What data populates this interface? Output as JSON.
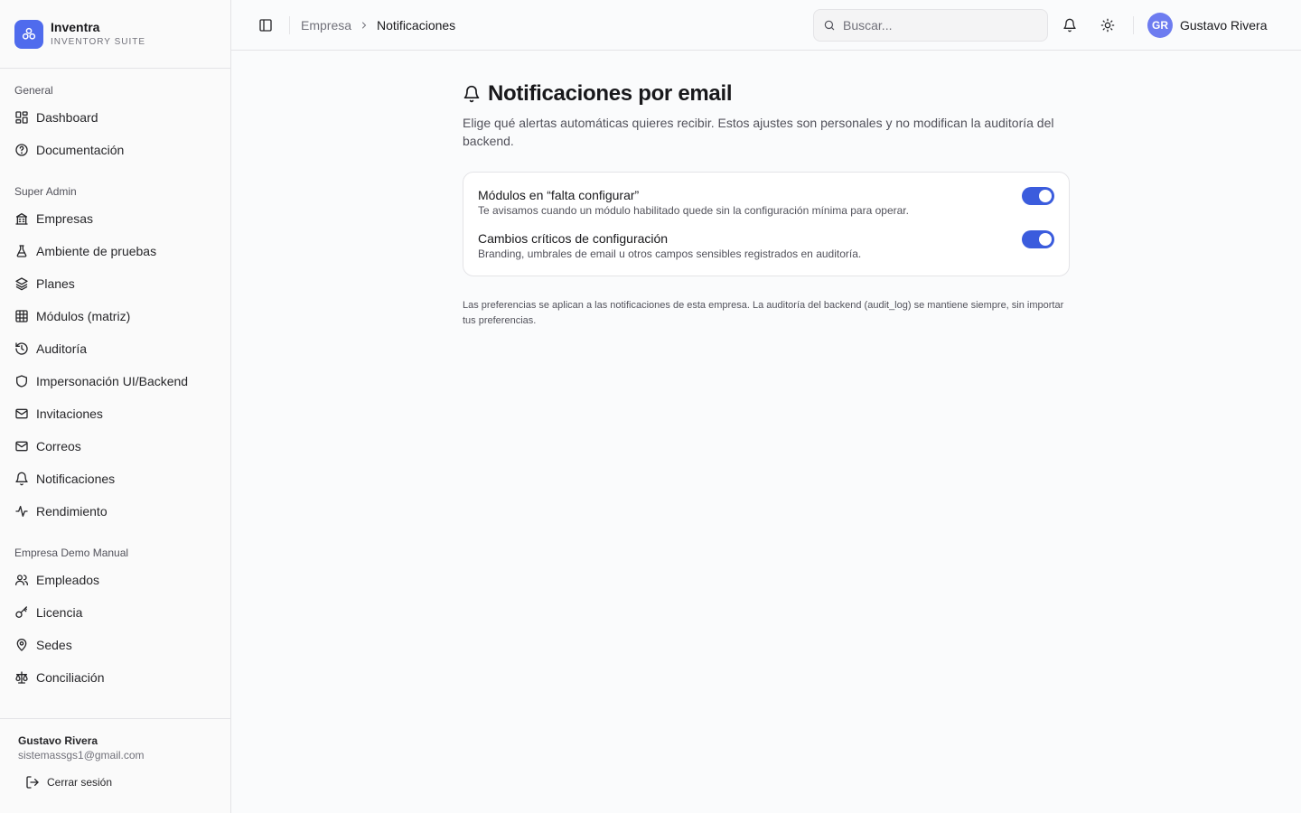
{
  "brand": {
    "name": "Inventra",
    "subtitle": "INVENTORY SUITE"
  },
  "sidebar": {
    "groups": [
      {
        "label": "General",
        "items": [
          {
            "label": "Dashboard",
            "icon": "dashboard-icon"
          },
          {
            "label": "Documentación",
            "icon": "help-circle-icon"
          }
        ]
      },
      {
        "label": "Super Admin",
        "items": [
          {
            "label": "Empresas",
            "icon": "building-icon"
          },
          {
            "label": "Ambiente de pruebas",
            "icon": "flask-icon"
          },
          {
            "label": "Planes",
            "icon": "layers-icon"
          },
          {
            "label": "Módulos (matriz)",
            "icon": "grid-icon"
          },
          {
            "label": "Auditoría",
            "icon": "history-icon"
          },
          {
            "label": "Impersonación UI/Backend",
            "icon": "shield-icon"
          },
          {
            "label": "Invitaciones",
            "icon": "mail-icon"
          },
          {
            "label": "Correos",
            "icon": "mail-icon"
          },
          {
            "label": "Notificaciones",
            "icon": "bell-icon"
          },
          {
            "label": "Rendimiento",
            "icon": "activity-icon"
          }
        ]
      },
      {
        "label": "Empresa Demo Manual",
        "items": [
          {
            "label": "Empleados",
            "icon": "users-icon"
          },
          {
            "label": "Licencia",
            "icon": "key-icon"
          },
          {
            "label": "Sedes",
            "icon": "map-pin-icon"
          },
          {
            "label": "Conciliación",
            "icon": "scale-icon"
          }
        ]
      }
    ],
    "footer": {
      "name": "Gustavo Rivera",
      "email": "sistemassgs1@gmail.com",
      "logout_label": "Cerrar sesión"
    }
  },
  "header": {
    "breadcrumb": {
      "parent": "Empresa",
      "current": "Notificaciones"
    },
    "search_placeholder": "Buscar...",
    "user": {
      "initials": "GR",
      "name": "Gustavo Rivera"
    }
  },
  "main": {
    "title": "Notificaciones por email",
    "description": "Elige qué alertas automáticas quieres recibir. Estos ajustes son personales y no modifican la auditoría del backend.",
    "preferences": [
      {
        "title": "Módulos en “falta configurar”",
        "description": "Te avisamos cuando un módulo habilitado quede sin la configuración mínima para operar.",
        "enabled": true
      },
      {
        "title": "Cambios críticos de configuración",
        "description": "Branding, umbrales de email u otros campos sensibles registrados en auditoría.",
        "enabled": true
      }
    ],
    "footnote": "Las preferencias se aplican a las notificaciones de esta empresa. La auditoría del backend (audit_log) se mantiene siempre, sin importar tus preferencias."
  },
  "colors": {
    "accent": "#3b5cdd",
    "brand": "#4f6bed",
    "avatar": "#6d7cf0"
  }
}
